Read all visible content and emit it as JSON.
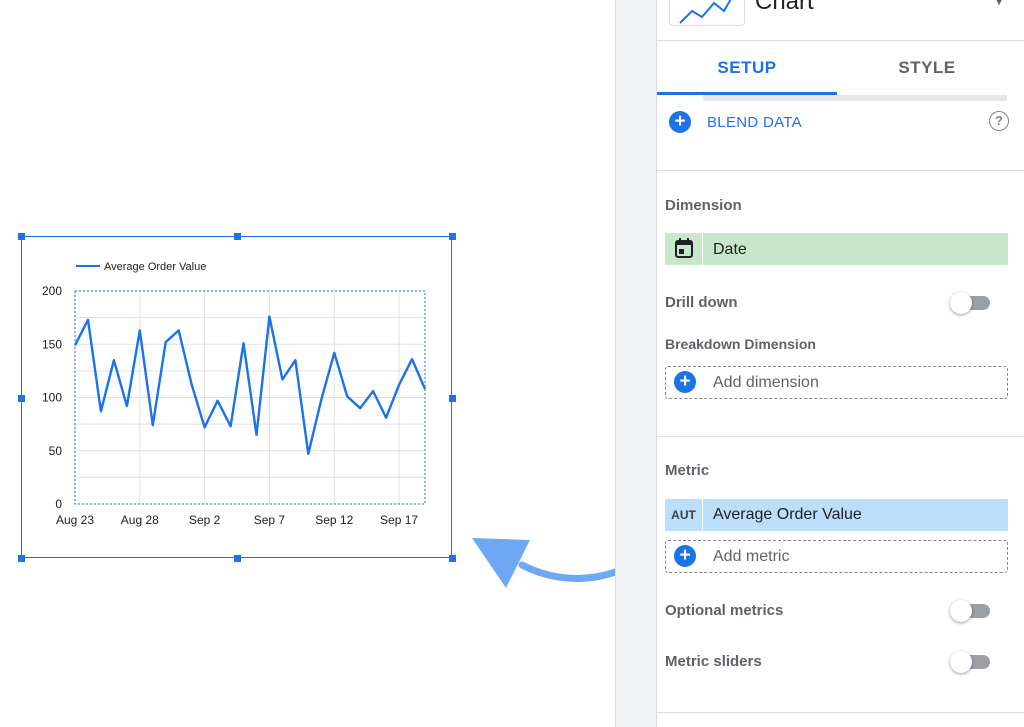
{
  "panel": {
    "chart_type_label": "Chart",
    "tabs": [
      {
        "label": "SETUP",
        "active": true
      },
      {
        "label": "STYLE",
        "active": false
      }
    ],
    "blend_data_label": "BLEND DATA",
    "help_icon": "?",
    "dimension": {
      "title": "Dimension",
      "chip_label": "Date",
      "chip_icon": "calendar-icon"
    },
    "drill_down": {
      "label": "Drill down",
      "enabled": false
    },
    "breakdown": {
      "title": "Breakdown Dimension",
      "add_label": "Add dimension"
    },
    "metric": {
      "title": "Metric",
      "chip_tag": "AUT",
      "chip_label": "Average Order Value",
      "add_label": "Add metric"
    },
    "optional_metrics": {
      "label": "Optional metrics",
      "enabled": false
    },
    "metric_sliders": {
      "label": "Metric sliders",
      "enabled": false
    }
  },
  "colors": {
    "accent": "#1a73e8",
    "dimension_chip": "#c8e6c9",
    "metric_chip": "#bbdefb",
    "arrow": "#6ea8f5"
  },
  "chart_data": {
    "type": "line",
    "title": "",
    "xlabel": "",
    "ylabel": "",
    "legend": "top-left",
    "grid": true,
    "ylim": [
      0,
      200
    ],
    "yticks": [
      0,
      50,
      100,
      150,
      200
    ],
    "xtick_labels": [
      "Aug 23",
      "Aug 28",
      "Sep 2",
      "Sep 7",
      "Sep 12",
      "Sep 17"
    ],
    "x": [
      "Aug 23",
      "Aug 24",
      "Aug 25",
      "Aug 26",
      "Aug 27",
      "Aug 28",
      "Aug 29",
      "Aug 30",
      "Aug 31",
      "Sep 1",
      "Sep 2",
      "Sep 3",
      "Sep 4",
      "Sep 5",
      "Sep 6",
      "Sep 7",
      "Sep 8",
      "Sep 9",
      "Sep 10",
      "Sep 11",
      "Sep 12",
      "Sep 13",
      "Sep 14",
      "Sep 15",
      "Sep 16",
      "Sep 17",
      "Sep 18",
      "Sep 19"
    ],
    "series": [
      {
        "name": "Average Order Value",
        "color": "#1a73e8",
        "values": [
          149,
          173,
          87,
          135,
          92,
          163,
          74,
          152,
          163,
          112,
          72,
          97,
          73,
          151,
          65,
          176,
          117,
          135,
          47,
          98,
          142,
          101,
          90,
          106,
          81,
          112,
          136,
          108
        ]
      }
    ]
  }
}
